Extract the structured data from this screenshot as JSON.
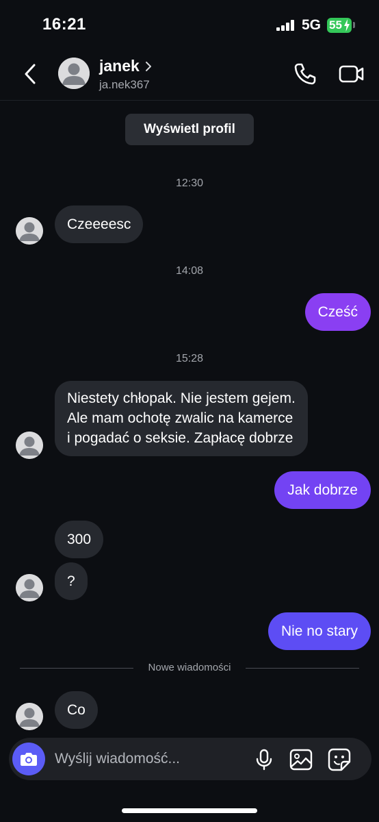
{
  "status_bar": {
    "time": "16:21",
    "network": "5G",
    "battery": "55",
    "battery_color": "#34c759"
  },
  "header": {
    "contact_name": "janek",
    "username": "ja.nek367",
    "icons": [
      "chevron-left-icon",
      "chevron-right-icon",
      "phone-icon",
      "video-icon"
    ]
  },
  "chat": {
    "view_profile_label": "Wyświetl profil",
    "timestamps": [
      "12:30",
      "14:08",
      "15:28"
    ],
    "messages": [
      {
        "side": "in",
        "text": "Czeeeesc"
      },
      {
        "side": "out",
        "text": "Cześć"
      },
      {
        "side": "in",
        "lines": [
          "Niestety chłopak. Nie jestem gejem.",
          "Ale mam ochotę zwalic na kamerce",
          "i pogadać o seksie. Zapłacę dobrze"
        ]
      },
      {
        "side": "out",
        "text": "Jak dobrze"
      },
      {
        "side": "in",
        "text": "300"
      },
      {
        "side": "in",
        "text": "?"
      },
      {
        "side": "out",
        "text": "Nie no stary"
      },
      {
        "side": "in",
        "text": "Co"
      }
    ],
    "divider_label": "Nowe wiadomości"
  },
  "composer": {
    "placeholder": "Wyślij wiadomość...",
    "icons": [
      "camera-icon",
      "microphone-icon",
      "gallery-icon",
      "sticker-icon"
    ]
  },
  "colors": {
    "background": "#0c0e12",
    "incoming_bubble": "#26292f",
    "outgoing_bubble_top": "#8a3ff2",
    "outgoing_bubble_bottom": "#5d4df4",
    "accent": "#5b5cf6"
  }
}
